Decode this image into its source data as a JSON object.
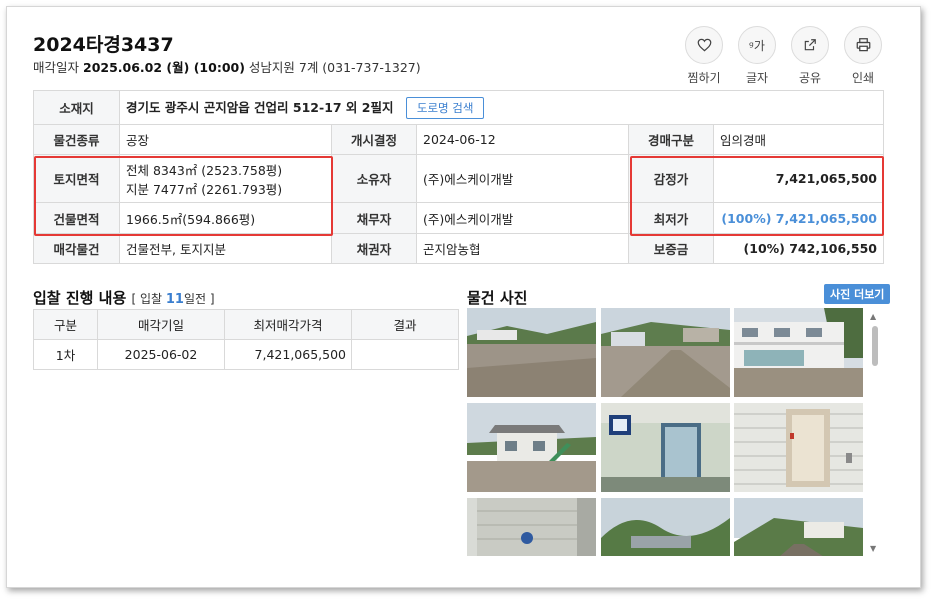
{
  "case": {
    "title": "2024타경3437",
    "sale_label": "매각일자",
    "sale_date": "2025.06.02 (월) (10:00)",
    "court": "성남지원 7계 (031-737-1327)"
  },
  "actions": [
    {
      "label": "찜하기",
      "icon": "heart-icon"
    },
    {
      "label": "글자",
      "icon": "font-size-icon",
      "glyph": "ᵍ가"
    },
    {
      "label": "공유",
      "icon": "share-icon"
    },
    {
      "label": "인쇄",
      "icon": "print-icon"
    }
  ],
  "info": {
    "location_label": "소재지",
    "location_value": "경기도 광주시 곤지암읍 건업리 512-17 외 2필지",
    "road_button": "도로명 검색",
    "type_label": "물건종류",
    "type_value": "공장",
    "open_label": "개시결정",
    "open_value": "2024-06-12",
    "auction_kind_label": "경매구분",
    "auction_kind_value": "임의경매",
    "land_label": "토지면적",
    "land_total": "전체 8343㎡ (2523.758평)",
    "land_share": "지분 7477㎡ (2261.793평)",
    "owner_label": "소유자",
    "owner_value": "(주)에스케이개발",
    "appraisal_label": "감정가",
    "appraisal_value": "7,421,065,500",
    "building_label": "건물면적",
    "building_value": "1966.5㎡(594.866평)",
    "debtor_label": "채무자",
    "debtor_value": "(주)에스케이개발",
    "min_label": "최저가",
    "min_value": "(100%) 7,421,065,500",
    "item_label": "매각물건",
    "item_value": "건물전부, 토지지분",
    "creditor_label": "채권자",
    "creditor_value": "곤지암농협",
    "deposit_label": "보증금",
    "deposit_value": "(10%) 742,106,550"
  },
  "bid": {
    "title": "입찰 진행 내용",
    "sub_prefix": "[ 입찰 ",
    "days": "11",
    "sub_suffix": "일전 ]",
    "headers": [
      "구분",
      "매각기일",
      "최저매각가격",
      "결과"
    ],
    "rows": [
      [
        "1차",
        "2025-06-02",
        "7,421,065,500",
        ""
      ]
    ]
  },
  "photos": {
    "title": "물건 사진",
    "more_button": "사진 더보기",
    "count": 9
  },
  "colors": {
    "accent": "#4a8fd8",
    "highlight_box": "#e53935",
    "header_bg": "#f5f6f7"
  }
}
